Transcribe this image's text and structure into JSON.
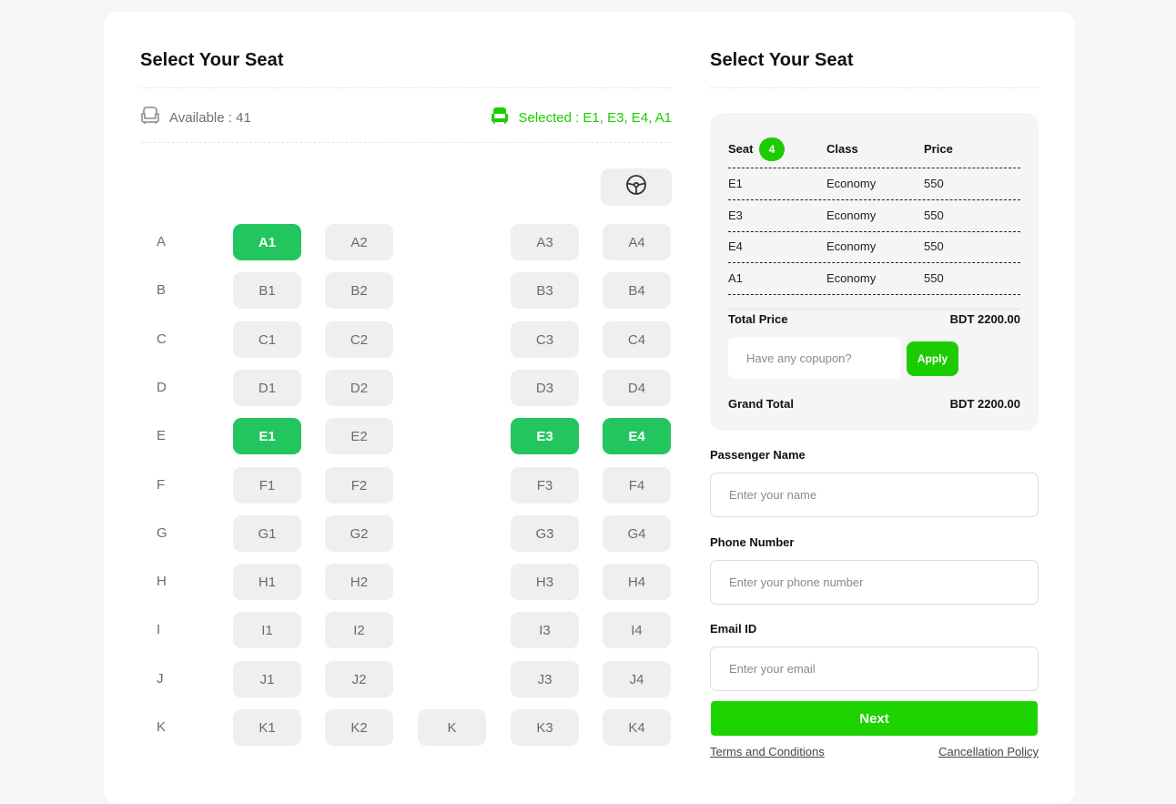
{
  "seat_map": {
    "title": "Select Your Seat",
    "available_label": "Available : 41",
    "selected_label": "Selected : E1, E3, E4, A1",
    "rows": [
      {
        "label": "A",
        "seats": [
          {
            "id": "A1",
            "selected": true
          },
          {
            "id": "A2",
            "selected": false
          },
          {
            "id": "A3",
            "selected": false
          },
          {
            "id": "A4",
            "selected": false
          }
        ]
      },
      {
        "label": "B",
        "seats": [
          {
            "id": "B1",
            "selected": false
          },
          {
            "id": "B2",
            "selected": false
          },
          {
            "id": "B3",
            "selected": false
          },
          {
            "id": "B4",
            "selected": false
          }
        ]
      },
      {
        "label": "C",
        "seats": [
          {
            "id": "C1",
            "selected": false
          },
          {
            "id": "C2",
            "selected": false
          },
          {
            "id": "C3",
            "selected": false
          },
          {
            "id": "C4",
            "selected": false
          }
        ]
      },
      {
        "label": "D",
        "seats": [
          {
            "id": "D1",
            "selected": false
          },
          {
            "id": "D2",
            "selected": false
          },
          {
            "id": "D3",
            "selected": false
          },
          {
            "id": "D4",
            "selected": false
          }
        ]
      },
      {
        "label": "E",
        "seats": [
          {
            "id": "E1",
            "selected": true
          },
          {
            "id": "E2",
            "selected": false
          },
          {
            "id": "E3",
            "selected": true
          },
          {
            "id": "E4",
            "selected": true
          }
        ]
      },
      {
        "label": "F",
        "seats": [
          {
            "id": "F1",
            "selected": false
          },
          {
            "id": "F2",
            "selected": false
          },
          {
            "id": "F3",
            "selected": false
          },
          {
            "id": "F4",
            "selected": false
          }
        ]
      },
      {
        "label": "G",
        "seats": [
          {
            "id": "G1",
            "selected": false
          },
          {
            "id": "G2",
            "selected": false
          },
          {
            "id": "G3",
            "selected": false
          },
          {
            "id": "G4",
            "selected": false
          }
        ]
      },
      {
        "label": "H",
        "seats": [
          {
            "id": "H1",
            "selected": false
          },
          {
            "id": "H2",
            "selected": false
          },
          {
            "id": "H3",
            "selected": false
          },
          {
            "id": "H4",
            "selected": false
          }
        ]
      },
      {
        "label": "I",
        "seats": [
          {
            "id": "I1",
            "selected": false
          },
          {
            "id": "I2",
            "selected": false
          },
          {
            "id": "I3",
            "selected": false
          },
          {
            "id": "I4",
            "selected": false
          }
        ]
      },
      {
        "label": "J",
        "seats": [
          {
            "id": "J1",
            "selected": false
          },
          {
            "id": "J2",
            "selected": false
          },
          {
            "id": "J3",
            "selected": false
          },
          {
            "id": "J4",
            "selected": false
          }
        ]
      },
      {
        "label": "K",
        "seats": [
          {
            "id": "K1",
            "selected": false
          },
          {
            "id": "K2",
            "selected": false
          },
          {
            "id": "K",
            "selected": false
          },
          {
            "id": "K3",
            "selected": false
          },
          {
            "id": "K4",
            "selected": false
          }
        ]
      }
    ],
    "icons": {
      "available": "seat-outline-icon",
      "selected": "seat-filled-icon",
      "driver": "steering-wheel-icon"
    },
    "colors": {
      "selected_seat": "#22c55e",
      "accent": "#1dcc00",
      "seat_bg": "#efefef"
    }
  },
  "summary": {
    "title": "Select Your Seat",
    "headers": {
      "seat": "Seat",
      "class": "Class",
      "price": "Price"
    },
    "count": "4",
    "rows": [
      {
        "seat": "E1",
        "class": "Economy",
        "price": "550"
      },
      {
        "seat": "E3",
        "class": "Economy",
        "price": "550"
      },
      {
        "seat": "E4",
        "class": "Economy",
        "price": "550"
      },
      {
        "seat": "A1",
        "class": "Economy",
        "price": "550"
      }
    ],
    "total_label": "Total Price",
    "total_value": "BDT 2200.00",
    "coupon_placeholder": "Have any copupon?",
    "apply_label": "Apply",
    "grand_label": "Grand Total",
    "grand_value": "BDT 2200.00"
  },
  "form": {
    "name_label": "Passenger Name",
    "name_placeholder": "Enter your name",
    "phone_label": "Phone Number",
    "phone_placeholder": "Enter your phone number",
    "email_label": "Email ID",
    "email_placeholder": "Enter your email",
    "next_label": "Next",
    "terms_link": "Terms and Conditions",
    "cancel_link": "Cancellation Policy"
  }
}
